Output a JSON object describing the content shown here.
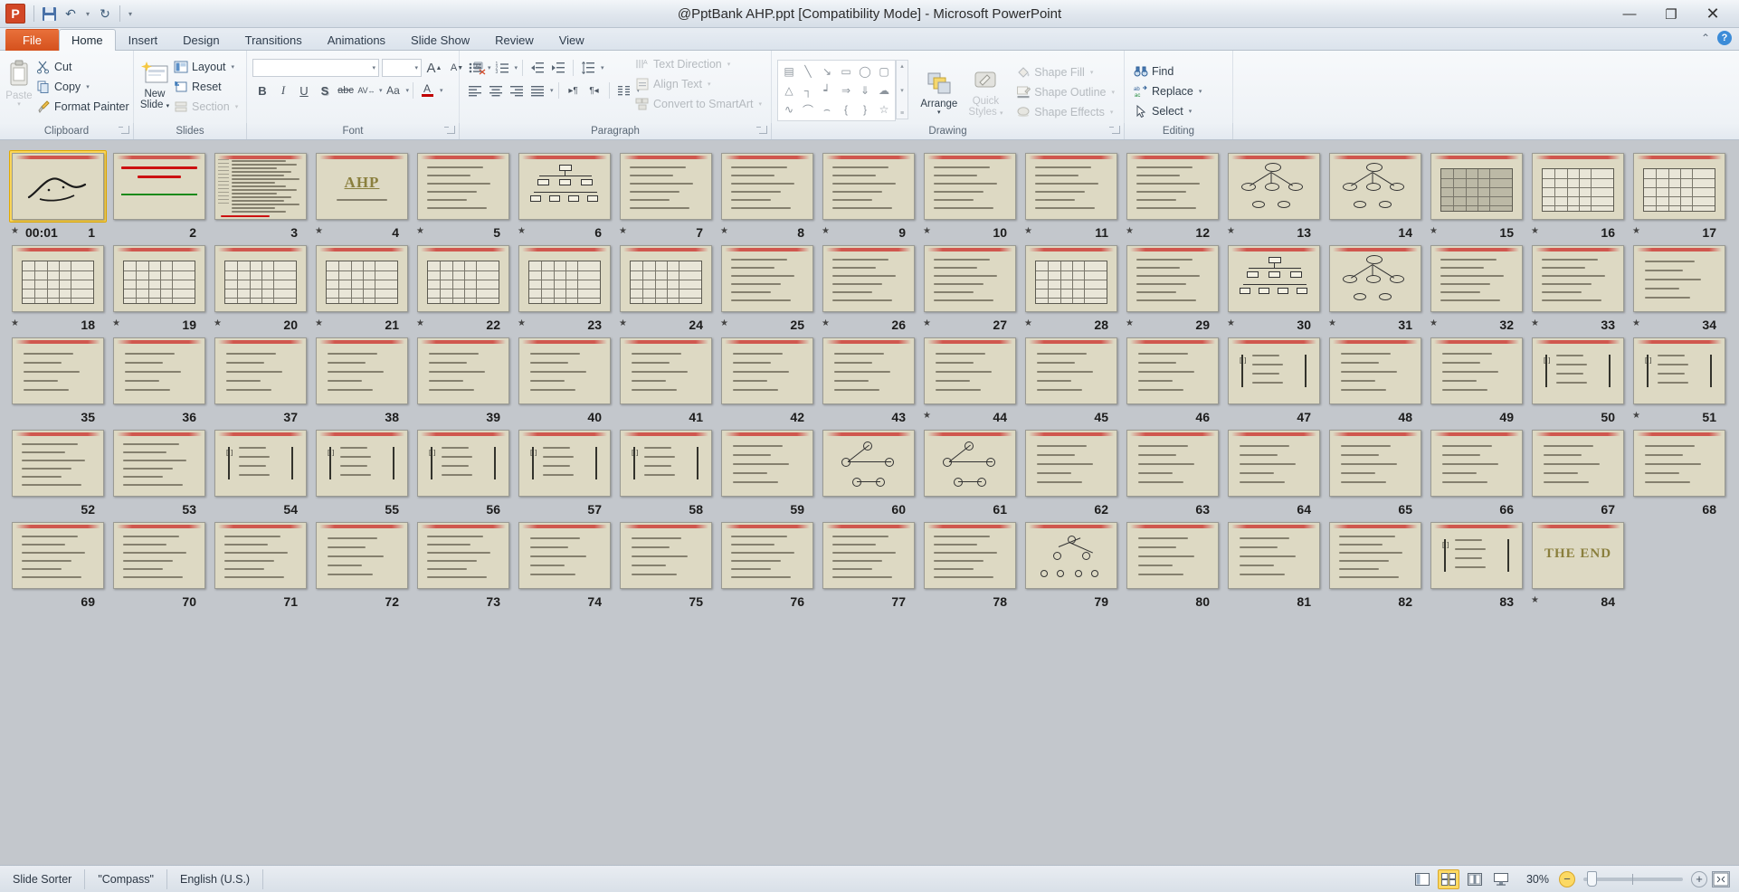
{
  "window": {
    "title": "@PptBank AHP.ppt [Compatibility Mode]  -  Microsoft PowerPoint",
    "minimize": "—",
    "restore": "❐",
    "close": "✕"
  },
  "quick_access": {
    "logo": "P",
    "save": "save-icon",
    "undo": "↶",
    "undo_caret": "▾",
    "redo": "↻",
    "customize_caret": "▾"
  },
  "tabs": [
    {
      "label": "File",
      "id": "file"
    },
    {
      "label": "Home",
      "id": "home"
    },
    {
      "label": "Insert",
      "id": "insert"
    },
    {
      "label": "Design",
      "id": "design"
    },
    {
      "label": "Transitions",
      "id": "transitions"
    },
    {
      "label": "Animations",
      "id": "animations"
    },
    {
      "label": "Slide Show",
      "id": "slideshow"
    },
    {
      "label": "Review",
      "id": "review"
    },
    {
      "label": "View",
      "id": "view"
    }
  ],
  "tab_right": {
    "minimize_ribbon": "⌃",
    "help": "?"
  },
  "ribbon": {
    "groups": [
      {
        "name": "Clipboard",
        "label": "Clipboard",
        "dialog": true
      },
      {
        "name": "Slides",
        "label": "Slides",
        "dialog": false
      },
      {
        "name": "Font",
        "label": "Font",
        "dialog": true
      },
      {
        "name": "Paragraph",
        "label": "Paragraph",
        "dialog": true
      },
      {
        "name": "Drawing",
        "label": "Drawing",
        "dialog": true
      },
      {
        "name": "Editing",
        "label": "Editing",
        "dialog": false
      }
    ],
    "clipboard": {
      "paste": "Paste",
      "paste_caret": "▾",
      "cut": "Cut",
      "copy": "Copy",
      "copy_caret": "▾",
      "format_painter": "Format Painter"
    },
    "slides": {
      "new_slide_line1": "New",
      "new_slide_line2": "Slide",
      "new_slide_caret": "▾",
      "layout": "Layout",
      "layout_caret": "▾",
      "reset": "Reset",
      "section": "Section",
      "section_caret": "▾"
    },
    "font": {
      "font_name_value": "",
      "font_size_value": "",
      "grow_font": "A",
      "shrink_font": "A",
      "clear_formatting": "clear-formatting-icon",
      "bold": "B",
      "italic": "I",
      "underline": "U",
      "shadow": "S",
      "strikethrough": "abc",
      "character_spacing": "AV",
      "change_case": "Aa",
      "font_color": "A"
    },
    "paragraph": {
      "bullets": "bullets-icon",
      "numbering": "numbering-icon",
      "decrease_indent": "decrease-indent-icon",
      "increase_indent": "increase-indent-icon",
      "line_spacing": "line-spacing-icon",
      "align_left": "align-left-icon",
      "align_center": "align-center-icon",
      "align_right": "align-right-icon",
      "justify": "justify-icon",
      "ltr": "▸¶",
      "rtl": "¶◂",
      "columns": "columns-icon",
      "text_direction": "Text Direction",
      "align_text": "Align Text",
      "convert_to_smartart": "Convert to SmartArt"
    },
    "drawing": {
      "shapes": [
        "text-box",
        "line",
        "arrow",
        "rectangle",
        "oval",
        "rounded-rectangle",
        "triangle",
        "elbow-connector",
        "elbow-arrow-connector",
        "right-arrow",
        "down-arrow",
        "cloud-shape",
        "scribble",
        "curve",
        "arc",
        "left-brace",
        "right-brace",
        "star"
      ],
      "shape_glyphs": [
        "▤",
        "╲",
        "↘",
        "▭",
        "◯",
        "▢",
        "△",
        "┐",
        "┙",
        "⇒",
        "⇓",
        "☁",
        "∿",
        "⌒",
        "⌢",
        "{",
        "}",
        "☆"
      ],
      "scroll_up": "▴",
      "scroll_down": "▾",
      "scroll_more": "≡",
      "arrange": "Arrange",
      "arrange_caret": "▾",
      "quick_styles_line1": "Quick",
      "quick_styles_line2": "Styles",
      "quick_styles_caret": "▾",
      "shape_fill": "Shape Fill",
      "shape_outline": "Shape Outline",
      "shape_effects": "Shape Effects"
    },
    "editing": {
      "find": "Find",
      "replace": "Replace",
      "replace_caret": "▾",
      "select": "Select",
      "select_caret": "▾"
    }
  },
  "slide_sorter": {
    "selected_slide": 1,
    "timing_label": "00:01",
    "columns": 17,
    "slides": [
      {
        "n": 1,
        "type": "bismillah",
        "animated": true,
        "timing": "00:01"
      },
      {
        "n": 2,
        "type": "pptbank",
        "animated": false
      },
      {
        "n": 3,
        "type": "dense-text",
        "animated": false
      },
      {
        "n": 4,
        "type": "title-ahp",
        "animated": true,
        "title": "AHP"
      },
      {
        "n": 5,
        "type": "text",
        "animated": true
      },
      {
        "n": 6,
        "type": "org-chart",
        "animated": true
      },
      {
        "n": 7,
        "type": "text",
        "animated": true
      },
      {
        "n": 8,
        "type": "text",
        "animated": true
      },
      {
        "n": 9,
        "type": "text",
        "animated": true
      },
      {
        "n": 10,
        "type": "text",
        "animated": true
      },
      {
        "n": 11,
        "type": "text",
        "animated": true
      },
      {
        "n": 12,
        "type": "text",
        "animated": true
      },
      {
        "n": 13,
        "type": "network",
        "animated": true
      },
      {
        "n": 14,
        "type": "network",
        "animated": false
      },
      {
        "n": 15,
        "type": "table-dark",
        "animated": true
      },
      {
        "n": 16,
        "type": "table",
        "animated": true
      },
      {
        "n": 17,
        "type": "table",
        "animated": true
      },
      {
        "n": 18,
        "type": "table",
        "animated": true
      },
      {
        "n": 19,
        "type": "table",
        "animated": true
      },
      {
        "n": 20,
        "type": "table",
        "animated": true
      },
      {
        "n": 21,
        "type": "table",
        "animated": true
      },
      {
        "n": 22,
        "type": "table",
        "animated": true
      },
      {
        "n": 23,
        "type": "table",
        "animated": true
      },
      {
        "n": 24,
        "type": "table",
        "animated": true
      },
      {
        "n": 25,
        "type": "text",
        "animated": true
      },
      {
        "n": 26,
        "type": "text",
        "animated": true
      },
      {
        "n": 27,
        "type": "text",
        "animated": true
      },
      {
        "n": 28,
        "type": "table",
        "animated": true
      },
      {
        "n": 29,
        "type": "text",
        "animated": true
      },
      {
        "n": 30,
        "type": "org-chart",
        "animated": true
      },
      {
        "n": 31,
        "type": "network",
        "animated": true
      },
      {
        "n": 32,
        "type": "text",
        "animated": true
      },
      {
        "n": 33,
        "type": "text",
        "animated": true
      },
      {
        "n": 34,
        "type": "formula",
        "animated": true
      },
      {
        "n": 35,
        "type": "formula",
        "animated": false
      },
      {
        "n": 36,
        "type": "formula",
        "animated": false
      },
      {
        "n": 37,
        "type": "formula",
        "animated": false
      },
      {
        "n": 38,
        "type": "formula",
        "animated": false
      },
      {
        "n": 39,
        "type": "formula",
        "animated": false
      },
      {
        "n": 40,
        "type": "formula",
        "animated": false
      },
      {
        "n": 41,
        "type": "formula",
        "animated": false
      },
      {
        "n": 42,
        "type": "formula",
        "animated": false
      },
      {
        "n": 43,
        "type": "formula",
        "animated": false
      },
      {
        "n": 44,
        "type": "formula",
        "animated": true
      },
      {
        "n": 45,
        "type": "formula",
        "animated": false
      },
      {
        "n": 46,
        "type": "formula",
        "animated": false
      },
      {
        "n": 47,
        "type": "matrix",
        "animated": false
      },
      {
        "n": 48,
        "type": "formula",
        "animated": false
      },
      {
        "n": 49,
        "type": "formula",
        "animated": false
      },
      {
        "n": 50,
        "type": "matrix",
        "animated": false
      },
      {
        "n": 51,
        "type": "matrix",
        "animated": true
      },
      {
        "n": 52,
        "type": "text",
        "animated": false
      },
      {
        "n": 53,
        "type": "text",
        "animated": false
      },
      {
        "n": 54,
        "type": "matrix",
        "animated": false
      },
      {
        "n": 55,
        "type": "matrix",
        "animated": false
      },
      {
        "n": 56,
        "type": "matrix",
        "animated": false
      },
      {
        "n": 57,
        "type": "matrix",
        "animated": false
      },
      {
        "n": 58,
        "type": "matrix",
        "animated": false
      },
      {
        "n": 59,
        "type": "formula",
        "animated": false
      },
      {
        "n": 60,
        "type": "graph",
        "animated": false
      },
      {
        "n": 61,
        "type": "graph",
        "animated": false
      },
      {
        "n": 62,
        "type": "formula",
        "animated": false
      },
      {
        "n": 63,
        "type": "formula",
        "animated": false
      },
      {
        "n": 64,
        "type": "formula",
        "animated": false
      },
      {
        "n": 65,
        "type": "formula",
        "animated": false
      },
      {
        "n": 66,
        "type": "formula",
        "animated": false
      },
      {
        "n": 67,
        "type": "formula",
        "animated": false
      },
      {
        "n": 68,
        "type": "formula",
        "animated": false
      },
      {
        "n": 69,
        "type": "text",
        "animated": false
      },
      {
        "n": 70,
        "type": "text",
        "animated": false
      },
      {
        "n": 71,
        "type": "text",
        "animated": false
      },
      {
        "n": 72,
        "type": "formula",
        "animated": false
      },
      {
        "n": 73,
        "type": "text",
        "animated": false
      },
      {
        "n": 74,
        "type": "formula",
        "animated": false
      },
      {
        "n": 75,
        "type": "formula",
        "animated": false
      },
      {
        "n": 76,
        "type": "text",
        "animated": false
      },
      {
        "n": 77,
        "type": "text",
        "animated": false
      },
      {
        "n": 78,
        "type": "text",
        "animated": false
      },
      {
        "n": 79,
        "type": "tree",
        "animated": false
      },
      {
        "n": 80,
        "type": "formula",
        "animated": false
      },
      {
        "n": 81,
        "type": "formula",
        "animated": false
      },
      {
        "n": 82,
        "type": "text",
        "animated": false
      },
      {
        "n": 83,
        "type": "matrix",
        "animated": false
      },
      {
        "n": 84,
        "type": "the-end",
        "animated": true,
        "title": "THE END"
      }
    ]
  },
  "status_bar": {
    "view_mode": "Slide Sorter",
    "theme": "\"Compass\"",
    "language": "English (U.S.)",
    "views": [
      {
        "name": "normal-view",
        "glyph": "◫",
        "active": false
      },
      {
        "name": "slide-sorter-view",
        "glyph": "▒",
        "active": true
      },
      {
        "name": "reading-view",
        "glyph": "☷",
        "active": false
      },
      {
        "name": "slide-show-view",
        "glyph": "❐",
        "active": false
      }
    ],
    "zoom_level": "30%",
    "zoom_out": "−",
    "zoom_in": "+",
    "fit_to_window": "fit-slide-icon"
  },
  "colors": {
    "accent": "#d24726",
    "selection": "#fbd75b",
    "slide_bg": "#ddd9c3",
    "workspace": "#c3c7cc"
  }
}
